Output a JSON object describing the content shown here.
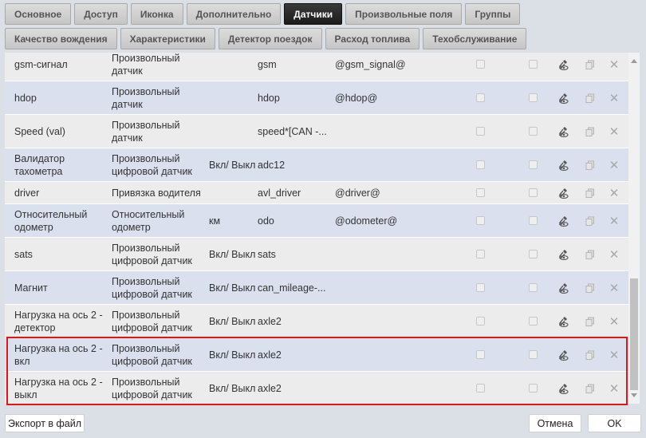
{
  "tabs_row1": [
    {
      "label": "Основное"
    },
    {
      "label": "Доступ"
    },
    {
      "label": "Иконка"
    },
    {
      "label": "Дополнительно"
    },
    {
      "label": "Датчики",
      "active": true
    },
    {
      "label": "Произвольные поля"
    },
    {
      "label": "Группы"
    }
  ],
  "tabs_row2": [
    {
      "label": "Качество вождения"
    },
    {
      "label": "Характеристики"
    },
    {
      "label": "Детектор поездок"
    },
    {
      "label": "Расход топлива"
    },
    {
      "label": "Техобслуживание"
    }
  ],
  "sensors": [
    {
      "name": "gsm-сигнал",
      "type": "Произвольный датчик",
      "unit": "",
      "param": "gsm",
      "desc": "@gsm_signal@",
      "highlighted": false
    },
    {
      "name": "hdop",
      "type": "Произвольный датчик",
      "unit": "",
      "param": "hdop",
      "desc": "@hdop@",
      "highlighted": false
    },
    {
      "name": "Speed (val)",
      "type": "Произвольный датчик",
      "unit": "",
      "param": "speed*[CAN -...",
      "desc": "",
      "highlighted": false
    },
    {
      "name": "Валидатор тахометра",
      "type": "Произвольный цифровой датчик",
      "unit": "Вкл/ Выкл",
      "param": "adc12",
      "desc": "",
      "highlighted": false
    },
    {
      "name": "driver",
      "type": "Привязка водителя",
      "unit": "",
      "param": "avl_driver",
      "desc": "@driver@",
      "highlighted": false
    },
    {
      "name": "Относительный одометр",
      "type": "Относительный одометр",
      "unit": "км",
      "param": "odo",
      "desc": "@odometer@",
      "highlighted": false
    },
    {
      "name": "sats",
      "type": "Произвольный цифровой датчик",
      "unit": "Вкл/ Выкл",
      "param": "sats",
      "desc": "",
      "highlighted": false
    },
    {
      "name": "Магнит",
      "type": "Произвольный цифровой датчик",
      "unit": "Вкл/ Выкл",
      "param": "can_mileage-...",
      "desc": "",
      "highlighted": false
    },
    {
      "name": "Нагрузка на ось 2 - детектор",
      "type": "Произвольный цифровой датчик",
      "unit": "Вкл/ Выкл",
      "param": "axle2",
      "desc": "",
      "highlighted": false
    },
    {
      "name": "Нагрузка на ось 2 - вкл",
      "type": "Произвольный цифровой датчик",
      "unit": "Вкл/ Выкл",
      "param": "axle2",
      "desc": "",
      "highlighted": true
    },
    {
      "name": "Нагрузка на ось 2 - выкл",
      "type": "Произвольный цифровой датчик",
      "unit": "Вкл/ Выкл",
      "param": "axle2",
      "desc": "",
      "highlighted": true
    }
  ],
  "row_icons": {
    "properties": "eye-wrench-icon",
    "copy": "copy-icon",
    "delete": "close-icon"
  },
  "footer": {
    "export_label": "Экспорт в файл",
    "cancel_label": "Отмена",
    "ok_label": "OK"
  },
  "colors": {
    "active_tab": "#1c1c1c",
    "highlight_border": "#e0141b",
    "row_alt": "#dbe0ef",
    "row_plain": "#ececec"
  }
}
